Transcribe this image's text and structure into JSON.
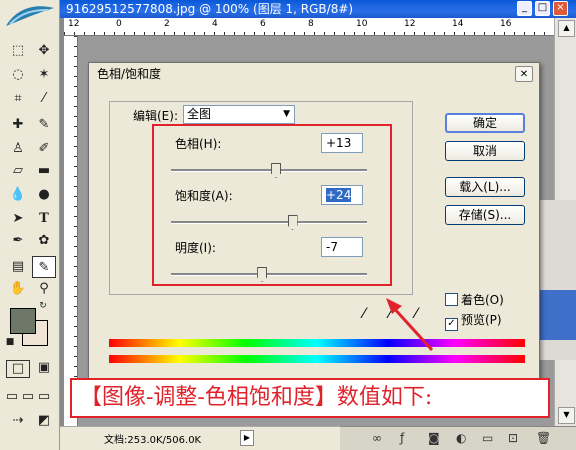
{
  "document": {
    "title": "91629512577808.jpg @ 100% (图层 1, RGB/8#)",
    "ruler_labels": [
      "12",
      "0",
      "2",
      "4",
      "6",
      "8",
      "10",
      "12",
      "14",
      "16"
    ],
    "status_doc_info": "文档:253.0K/506.0K"
  },
  "dialog": {
    "title": "色相/饱和度",
    "edit_label": "编辑(E):",
    "edit_value": "全图",
    "hue_label": "色相(H):",
    "hue_value": "+13",
    "saturation_label": "饱和度(A):",
    "saturation_value": "+24",
    "lightness_label": "明度(I):",
    "lightness_value": "-7",
    "ok_label": "确定",
    "cancel_label": "取消",
    "load_label": "载入(L)...",
    "save_label": "存储(S)...",
    "colorize_label": "着色(O)",
    "colorize_checked": false,
    "preview_label": "预览(P)",
    "preview_checked": true,
    "slider_levels": {
      "hue": 13,
      "saturation": 24,
      "lightness": -7
    }
  },
  "caption": "【图像-调整-色相饱和度】数值如下:",
  "colors": {
    "annotation_red": "#e0232b",
    "foreground_swatch": "#6e7868",
    "background_swatch": "#efe4d6",
    "title_blue": "#0a58d8"
  }
}
